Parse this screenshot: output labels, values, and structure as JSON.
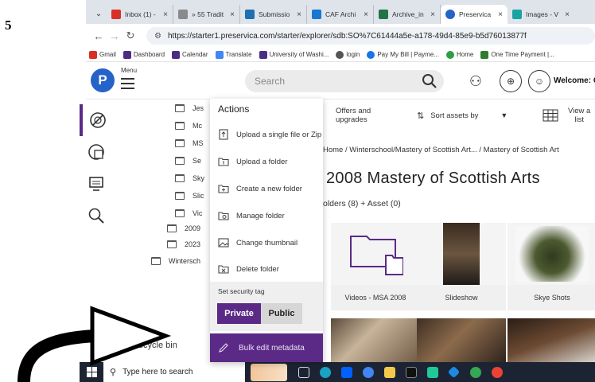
{
  "page_number": "5",
  "browser": {
    "tabs": [
      {
        "label": "Inbox (1) -",
        "color": "#d93025",
        "active": false
      },
      {
        "label": "» 55 Tradit",
        "color": "#8a8a8a",
        "active": false
      },
      {
        "label": "Submissio",
        "color": "#1f6fb2",
        "active": false
      },
      {
        "label": "CAF Archi",
        "color": "#1976d2",
        "active": false
      },
      {
        "label": "Archive_in",
        "color": "#217346",
        "active": false
      },
      {
        "label": "Preservica",
        "color": "#2563c9",
        "active": true
      },
      {
        "label": "Images - V",
        "color": "#1aa3a3",
        "active": false
      }
    ],
    "url": "https://starter1.preservica.com/starter/explorer/sdb:SO%7C61444a5e-a178-49d4-85e9-b5d76013877f",
    "bookmarks": [
      {
        "label": "Gmail",
        "color": "#d93025"
      },
      {
        "label": "Dashboard",
        "color": "#4b2e83"
      },
      {
        "label": "Calendar",
        "color": "#4b2e83"
      },
      {
        "label": "Translate",
        "color": "#4285f4"
      },
      {
        "label": "University of Washi...",
        "color": "#4b2e83"
      },
      {
        "label": "login",
        "color": "#555555"
      },
      {
        "label": "Pay My Bill | Payme...",
        "color": "#1a73e8"
      },
      {
        "label": "Home",
        "color": "#2e9e44"
      },
      {
        "label": "One Time Payment |...",
        "color": "#2e7d32"
      }
    ]
  },
  "header": {
    "menu_label": "Menu",
    "search_placeholder": "Search",
    "welcome": "Welcome: C"
  },
  "tree": {
    "items": [
      {
        "label": "Jes"
      },
      {
        "label": "Mc"
      },
      {
        "label": "MS"
      },
      {
        "label": "Se"
      },
      {
        "label": "Sky"
      },
      {
        "label": "Slic"
      },
      {
        "label": "Vic"
      },
      {
        "label": "2009"
      },
      {
        "label": "2023"
      },
      {
        "label": "Wintersch"
      }
    ],
    "recycle_bin": "Recycle bin"
  },
  "actions": {
    "title": "Actions",
    "items": [
      {
        "label": "Upload a single file or Zip"
      },
      {
        "label": "Upload a folder"
      },
      {
        "label": "Create a new folder"
      },
      {
        "label": "Manage folder"
      },
      {
        "label": "Change thumbnail"
      },
      {
        "label": "Delete folder"
      }
    ],
    "security_label": "Set security tag",
    "private_label": "Private",
    "public_label": "Public",
    "bulk_label": "Bulk edit metadata"
  },
  "main": {
    "offers_line1": "Offers and",
    "offers_line2": "upgrades",
    "sort_label": "Sort assets by",
    "view_line1": "View a",
    "view_line2": "list",
    "breadcrumb": "Home / Winterschool/Mastery of Scottish Art... / Mastery of Scottish Art",
    "title": "2008 Mastery of Scottish Arts",
    "counts": "olders (8) + Asset (0)",
    "cards": [
      {
        "label": "Videos - MSA 2008"
      },
      {
        "label": "Slideshow"
      },
      {
        "label": "Skye Shots"
      }
    ]
  },
  "taskbar": {
    "search_placeholder": "Type here to search"
  }
}
